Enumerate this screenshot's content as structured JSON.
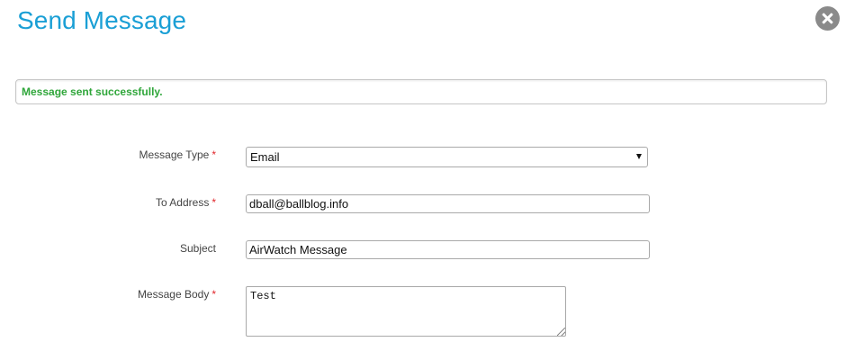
{
  "dialog": {
    "title": "Send Message",
    "close_icon": "close-circle-icon"
  },
  "status": {
    "message": "Message sent successfully."
  },
  "form": {
    "message_type": {
      "label": "Message Type",
      "required_marker": "*",
      "value": "Email"
    },
    "to_address": {
      "label": "To Address",
      "required_marker": "*",
      "value": "dball@ballblog.info"
    },
    "subject": {
      "label": "Subject",
      "value": "AirWatch Message"
    },
    "message_body": {
      "label": "Message Body",
      "required_marker": "*",
      "value": "Test"
    }
  },
  "colors": {
    "title": "#1a9fd5",
    "success": "#2fa63a",
    "required": "#e0262b",
    "close": "#8a8a8a"
  }
}
